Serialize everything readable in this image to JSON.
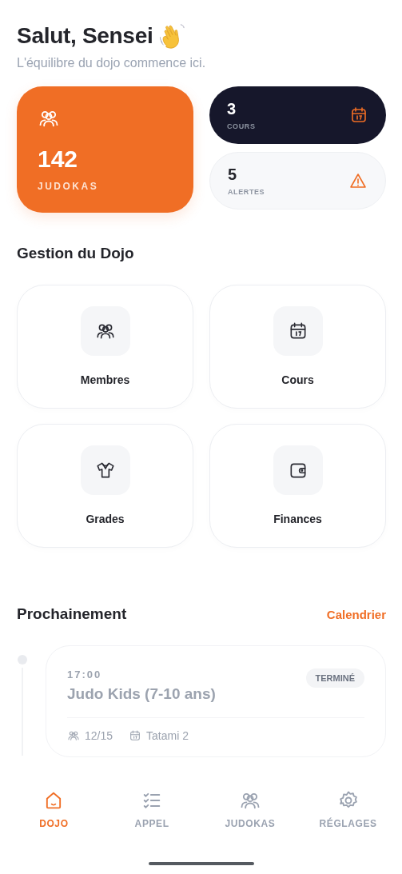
{
  "header": {
    "title": "Salut, Sensei",
    "subtitle": "L'équilibre du dojo commence ici."
  },
  "stats": [
    {
      "kind": "big",
      "value": "142",
      "label": "JUDOKAS"
    },
    {
      "kind": "dark",
      "value": "3",
      "label": "COURS"
    },
    {
      "kind": "light",
      "value": "5",
      "label": "ALERTES"
    }
  ],
  "management": {
    "title": "Gestion du Dojo",
    "items": [
      {
        "kind": "members",
        "label": "Membres"
      },
      {
        "kind": "classes",
        "label": "Cours"
      },
      {
        "kind": "grades",
        "label": "Grades"
      },
      {
        "kind": "finances",
        "label": "Finances"
      }
    ]
  },
  "upcoming": {
    "title": "Prochainement",
    "link": "Calendrier",
    "items": [
      {
        "time": "17:00",
        "title": "Judo Kids (7-10 ans)",
        "status": "TERMINÉ",
        "done": true,
        "attendance": "12/15",
        "place": "Tatami 2"
      }
    ]
  },
  "nav": [
    {
      "kind": "home",
      "label": "DOJO",
      "selected": true
    },
    {
      "kind": "checklist",
      "label": "APPEL",
      "selected": false
    },
    {
      "kind": "people",
      "label": "JUDOKAS",
      "selected": false
    },
    {
      "kind": "settings",
      "label": "RÉGLAGES",
      "selected": false
    }
  ]
}
